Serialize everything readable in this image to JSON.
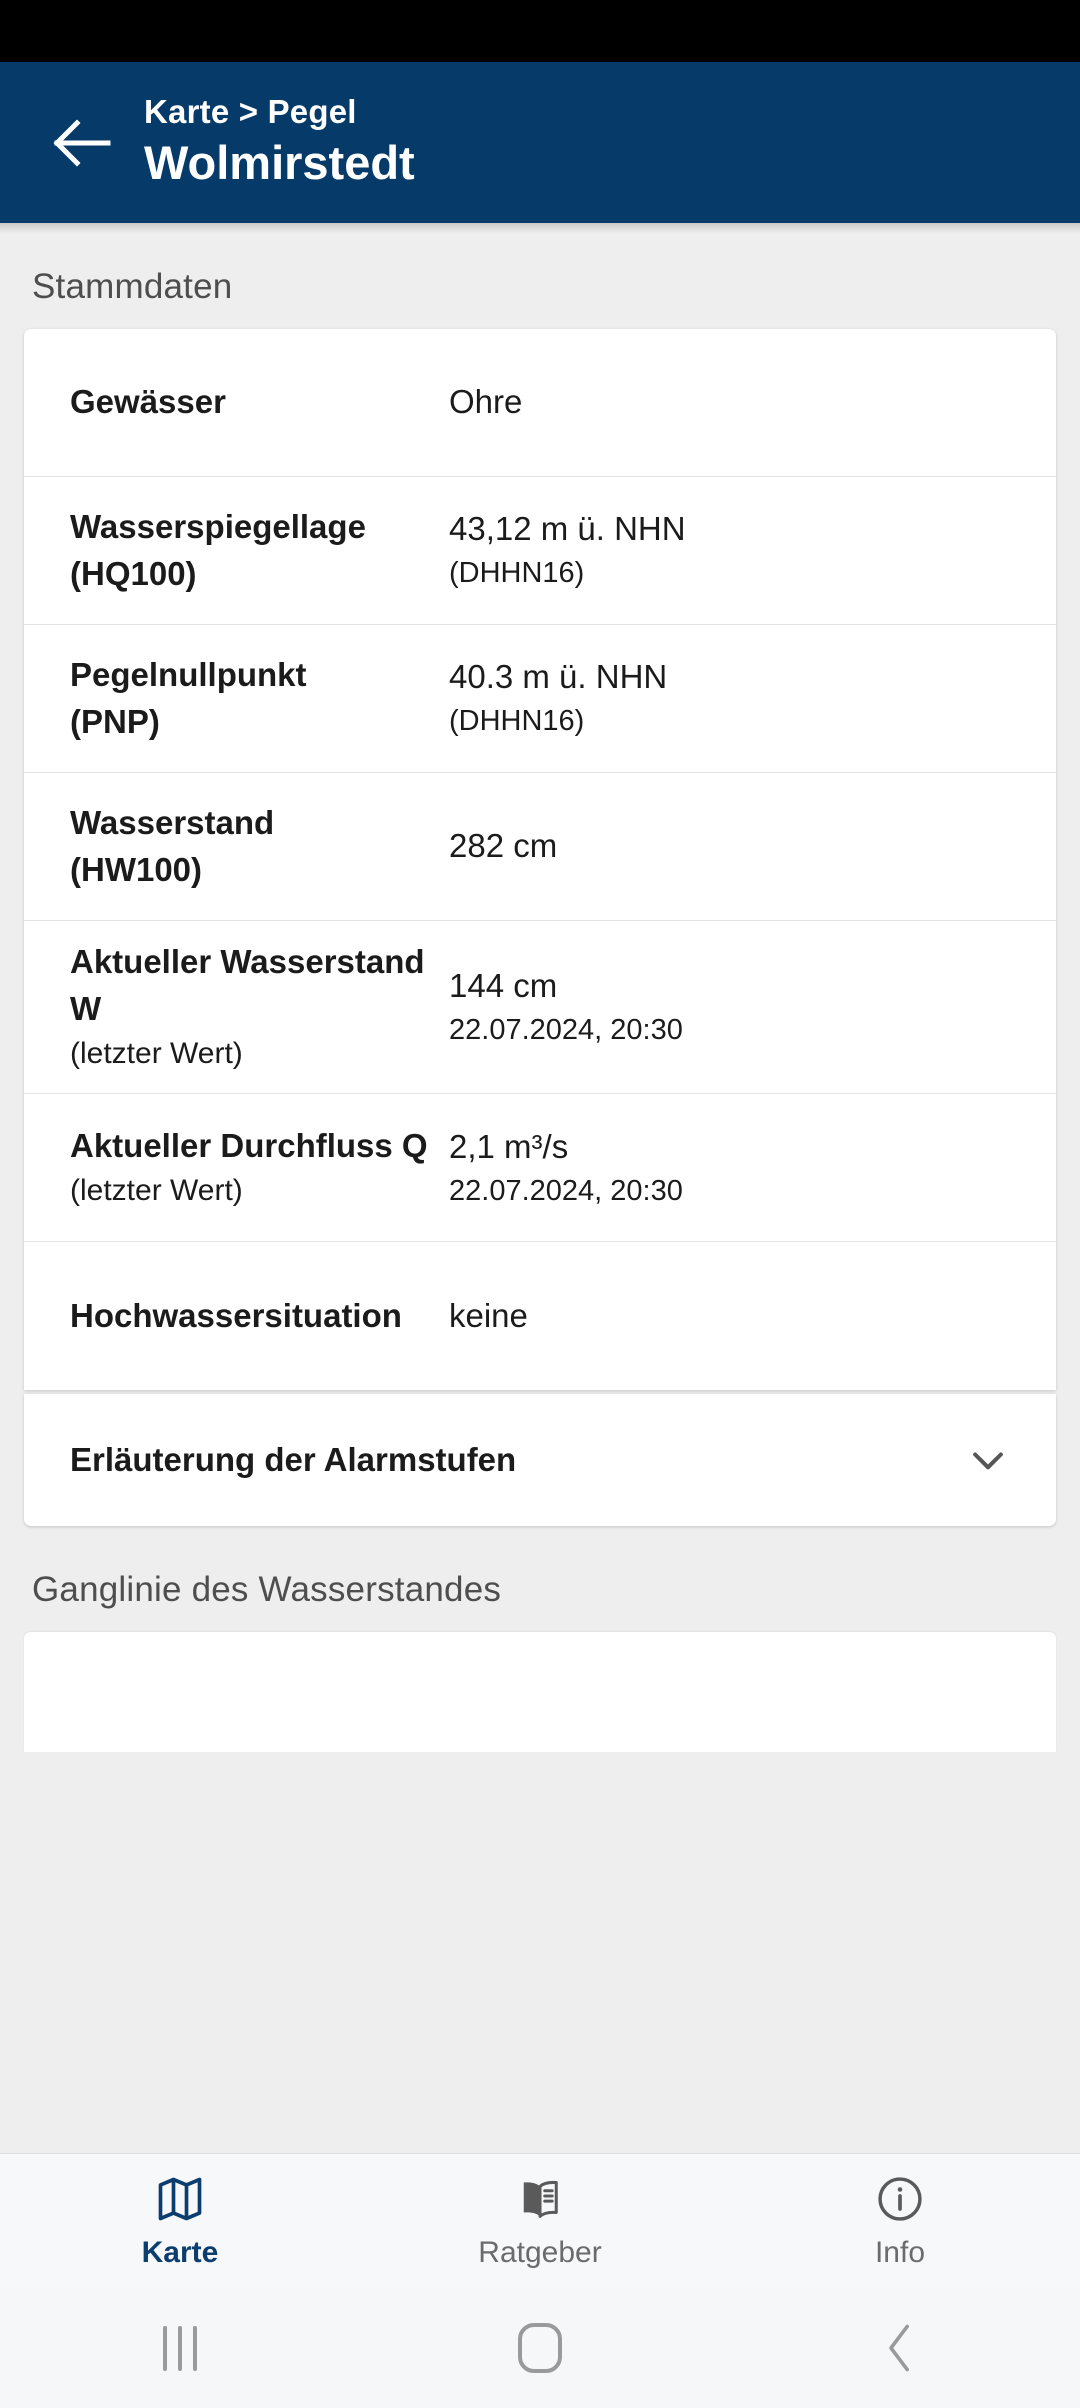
{
  "header": {
    "back_icon": "arrow-left-icon",
    "breadcrumb": "Karte > Pegel",
    "title": "Wolmirstedt",
    "background_color": "#063b69"
  },
  "sections": {
    "stammdaten_title": "Stammdaten",
    "ganglinie_title": "Ganglinie des Wasserstandes"
  },
  "stammdaten": {
    "rows": [
      {
        "label": "Gewässer",
        "label_sub": "",
        "value": "Ohre",
        "value_sub": ""
      },
      {
        "label": "Wasserspiegellage",
        "label_sub": "(HQ100)",
        "value": "43,12 m ü. NHN",
        "value_sub": "(DHHN16)"
      },
      {
        "label": "Pegelnullpunkt",
        "label_sub": "(PNP)",
        "value": "40.3 m ü. NHN",
        "value_sub": "(DHHN16)"
      },
      {
        "label": "Wasserstand",
        "label_sub": "(HW100)",
        "value": "282 cm",
        "value_sub": ""
      },
      {
        "label": "Aktueller Wasserstand W",
        "label_sub": "(letzter Wert)",
        "value": "144 cm",
        "value_sub": "22.07.2024, 20:30"
      },
      {
        "label": "Aktueller Durchfluss Q",
        "label_sub": "(letzter Wert)",
        "value": "2,1 m³/s",
        "value_sub": "22.07.2024, 20:30"
      },
      {
        "label": "Hochwassersituation",
        "label_sub": "",
        "value": "keine",
        "value_sub": ""
      }
    ]
  },
  "accordion": {
    "label": "Erläuterung der Alarmstufen",
    "icon": "chevron-down-icon",
    "expanded": false
  },
  "tab_bar": {
    "active_color": "#0b3d6e",
    "inactive_color": "#6b6b6b",
    "tabs": [
      {
        "label": "Karte",
        "icon": "map-icon",
        "active": true
      },
      {
        "label": "Ratgeber",
        "icon": "book-icon",
        "active": false
      },
      {
        "label": "Info",
        "icon": "info-circle-icon",
        "active": false
      }
    ]
  },
  "android_nav": {
    "recents": "recents-icon",
    "home": "home-icon",
    "back": "back-chevron-icon"
  }
}
